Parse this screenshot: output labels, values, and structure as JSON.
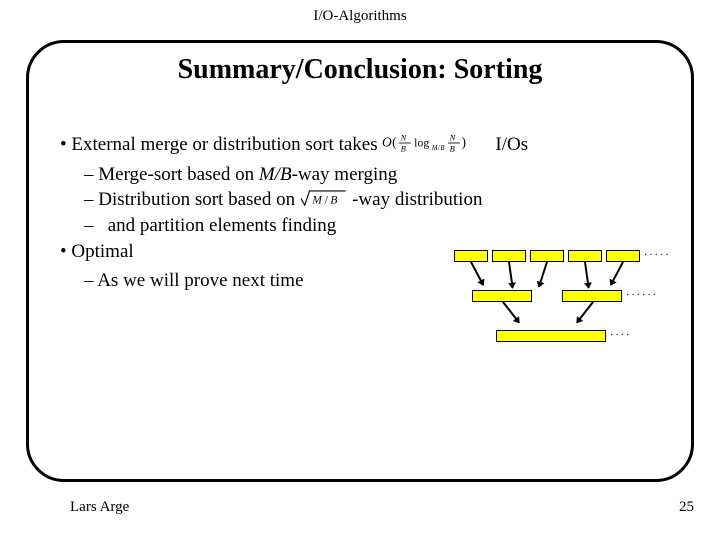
{
  "header": {
    "label": "I/O-Algorithms"
  },
  "title": "Summary/Conclusion: Sorting",
  "bullets": {
    "b1": "External merge or distribution sort takes ",
    "b1_end": " I/Os",
    "b1a_pre": "Merge-sort based on ",
    "b1a_mid": "M/B",
    "b1a_post": "-way merging",
    "b1b_pre": "Distribution sort based on ",
    "b1b_post": "-way distribution",
    "b1c": "and partition elements finding",
    "b2": "Optimal",
    "b2a": "As we will prove next time"
  },
  "footer": {
    "author": "Lars Arge",
    "page": "25"
  }
}
